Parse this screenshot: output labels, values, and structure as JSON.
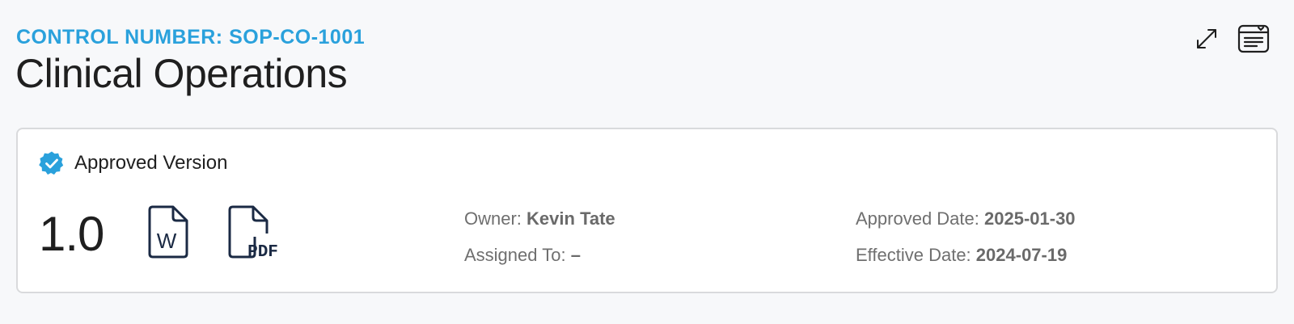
{
  "header": {
    "control_number": "CONTROL NUMBER: SOP-CO-1001",
    "title": "Clinical Operations",
    "actions": [
      {
        "name": "expand-icon"
      },
      {
        "name": "document-panel-icon"
      }
    ]
  },
  "version_card": {
    "status_label": "Approved Version",
    "status_icon": "verified-badge-icon",
    "status_color": "#2aa1dc",
    "version": "1.0",
    "downloads": {
      "word_icon": "word-document-icon",
      "word_glyph": "W",
      "pdf_icon": "pdf-document-icon",
      "pdf_glyph": "PDF"
    },
    "owner_label": "Owner:",
    "owner_value": "Kevin Tate",
    "assigned_label": "Assigned To:",
    "assigned_value": "–",
    "approved_label": "Approved Date:",
    "approved_value": "2025-01-30",
    "effective_label": "Effective Date:",
    "effective_value": "2024-07-19"
  },
  "colors": {
    "accent": "#2aa1dc",
    "icon_dark": "#1b2a44",
    "background": "#f7f8fa"
  }
}
